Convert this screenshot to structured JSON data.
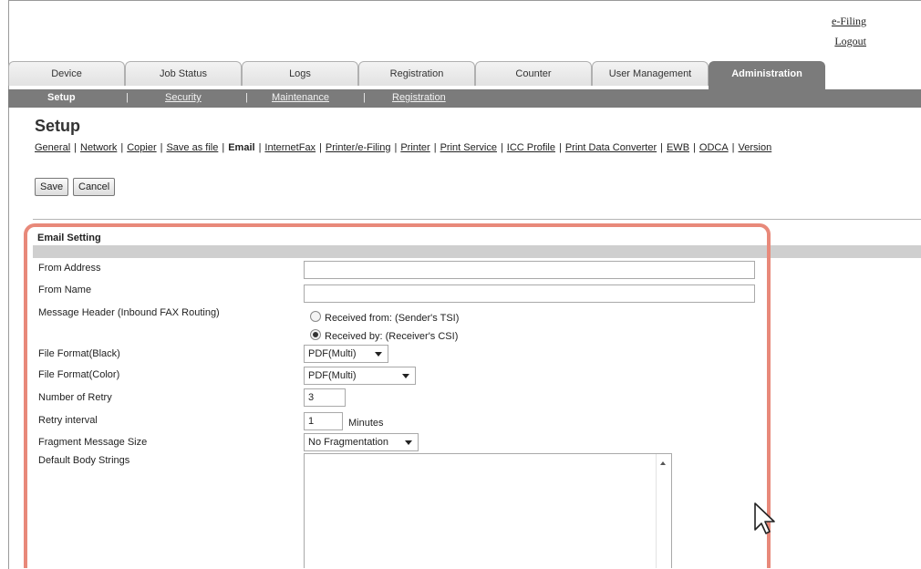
{
  "header_links": {
    "efiling": "e-Filing",
    "logout": "Logout"
  },
  "tabs": [
    {
      "label": "Device"
    },
    {
      "label": "Job Status"
    },
    {
      "label": "Logs"
    },
    {
      "label": "Registration"
    },
    {
      "label": "Counter"
    },
    {
      "label": "User Management"
    },
    {
      "label": "Administration"
    }
  ],
  "subnav": {
    "items": [
      "Setup",
      "Security",
      "Maintenance",
      "Registration"
    ],
    "separator": "|"
  },
  "page": {
    "title": "Setup"
  },
  "category_nav": {
    "items": [
      "General",
      "Network",
      "Copier",
      "Save as file",
      "Email",
      "InternetFax",
      "Printer/e-Filing",
      "Printer",
      "Print Service",
      "ICC Profile",
      "Print Data Converter",
      "EWB",
      "ODCA",
      "Version"
    ],
    "current": "Email",
    "separator": "|"
  },
  "buttons": {
    "save": "Save",
    "cancel": "Cancel"
  },
  "email_setting": {
    "section_title": "Email Setting",
    "from_address": {
      "label": "From Address",
      "value": ""
    },
    "from_name": {
      "label": "From Name",
      "value": ""
    },
    "message_header": {
      "label": "Message Header (Inbound FAX Routing)",
      "options": [
        "Received from: (Sender's TSI)",
        "Received by: (Receiver's CSI)"
      ],
      "selected": "Received by: (Receiver's CSI)"
    },
    "file_format_black": {
      "label": "File Format(Black)",
      "value": "PDF(Multi)"
    },
    "file_format_color": {
      "label": "File Format(Color)",
      "value": "PDF(Multi)"
    },
    "number_of_retry": {
      "label": "Number of Retry",
      "value": "3"
    },
    "retry_interval": {
      "label": "Retry interval",
      "value": "1",
      "unit": "Minutes"
    },
    "fragment_message_size": {
      "label": "Fragment Message Size",
      "value": "No Fragmentation"
    },
    "default_body_strings": {
      "label": "Default Body Strings",
      "value": ""
    }
  },
  "colors": {
    "highlight_border": "#e8897a",
    "active_tab": "#7b7b7b",
    "section_bar": "#cfcfcf"
  },
  "icons": [
    "radio-button",
    "dropdown-caret",
    "mouse-pointer-icon"
  ]
}
